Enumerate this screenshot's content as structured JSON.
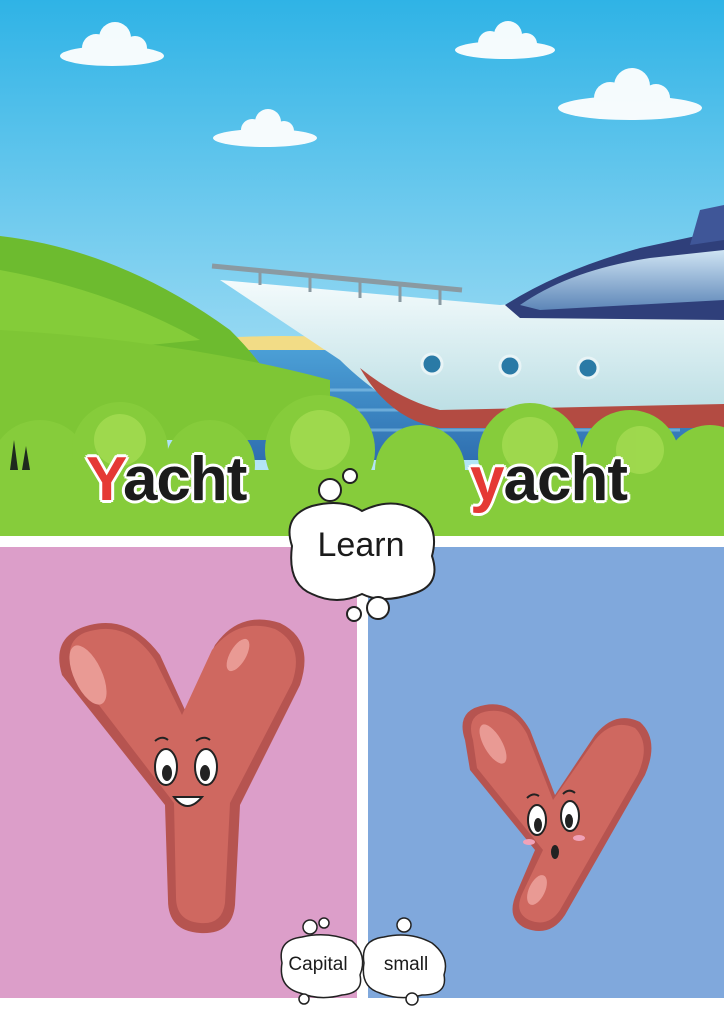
{
  "words": {
    "capital_first": "Y",
    "capital_rest": "acht",
    "small_first": "y",
    "small_rest": "acht"
  },
  "learn_label": "Learn",
  "labels": {
    "capital": "Capital",
    "small": "small"
  },
  "colors": {
    "sky": "#3cb9e6",
    "grass": "#7cc52e",
    "left_panel": "#dc9ec9",
    "right_panel": "#80a8dc",
    "letter": "#cf6860",
    "highlight": "#e53935"
  }
}
